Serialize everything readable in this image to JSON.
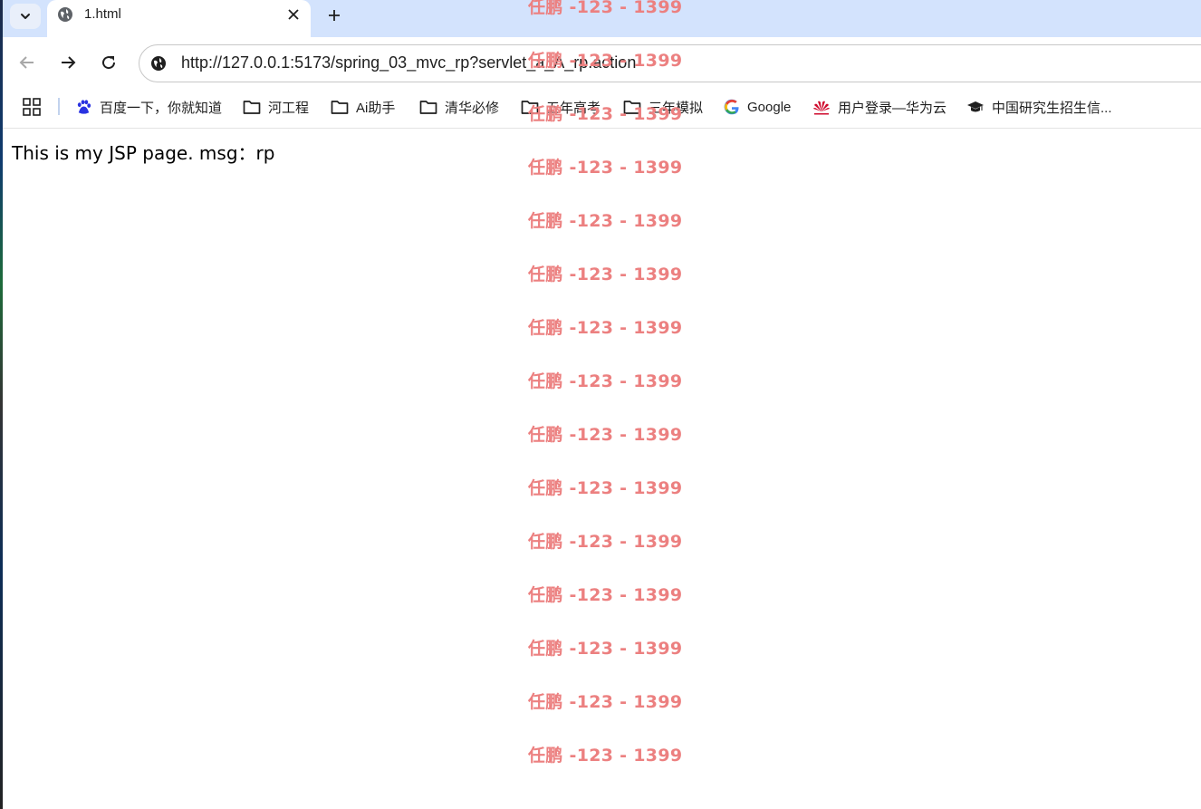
{
  "browser": {
    "tab": {
      "title": "1.html"
    },
    "address_bar": {
      "url": "http://127.0.0.1:5173/spring_03_mvc_rp?servlet_a_A_rp.action"
    },
    "bookmarks": [
      {
        "label": "百度一下，你就知道",
        "icon": "baidu-paw-icon"
      },
      {
        "label": "河工程",
        "icon": "folder-icon"
      },
      {
        "label": "Ai助手",
        "icon": "folder-icon"
      },
      {
        "label": "清华必修",
        "icon": "folder-icon"
      },
      {
        "label": "五年高考",
        "icon": "folder-icon"
      },
      {
        "label": "三年模拟",
        "icon": "folder-icon"
      },
      {
        "label": "Google",
        "icon": "google-g-icon"
      },
      {
        "label": "用户登录—华为云",
        "icon": "huawei-icon"
      },
      {
        "label": "中国研究生招生信...",
        "icon": "graduation-cap-icon"
      }
    ]
  },
  "page": {
    "text": "This is my JSP page. msg：rp",
    "watermark_text": "任鹏 -123 - 1399",
    "watermark_color": "#ec8080"
  }
}
